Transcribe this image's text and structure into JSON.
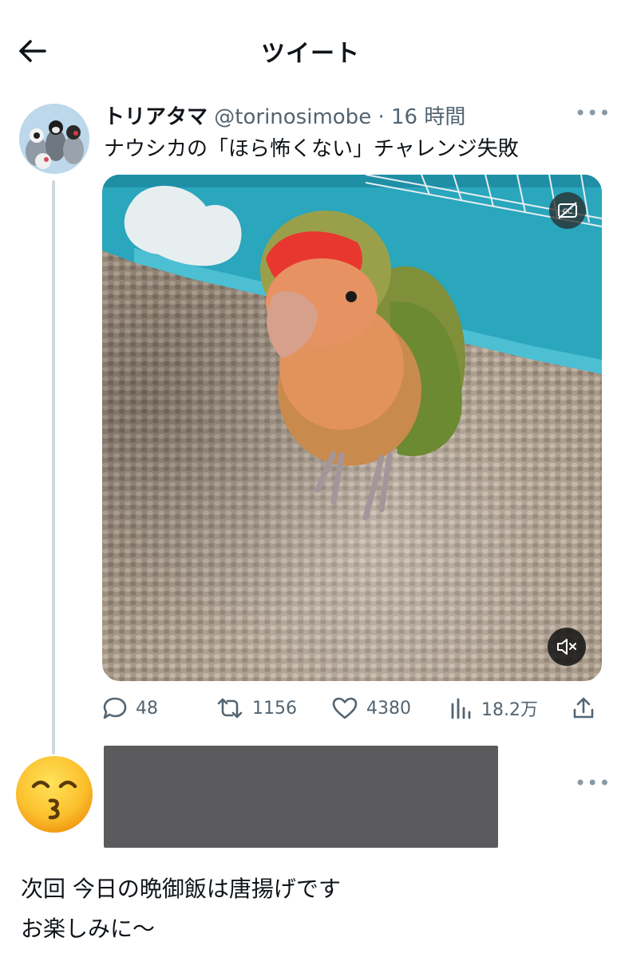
{
  "header": {
    "title": "ツイート"
  },
  "tweet": {
    "display_name": "トリアタマ",
    "handle": "@torinosimobe",
    "separator": "·",
    "time": "16 時間",
    "text": "ナウシカの「ほら怖くない」チャレンジ失敗",
    "more_label": "•••",
    "stats": {
      "replies": "48",
      "retweets": "1156",
      "likes": "4380",
      "views": "18.2万"
    }
  },
  "reply_card": {
    "more_label": "•••"
  },
  "caption": {
    "line1": "次回 今日の晩御飯は唐揚げです",
    "line2": "お楽しみに〜"
  },
  "colors": {
    "text": "#0f1419",
    "muted": "#536471",
    "thread_line": "#cfd9de",
    "redacted_block": "#5b5b5d"
  }
}
